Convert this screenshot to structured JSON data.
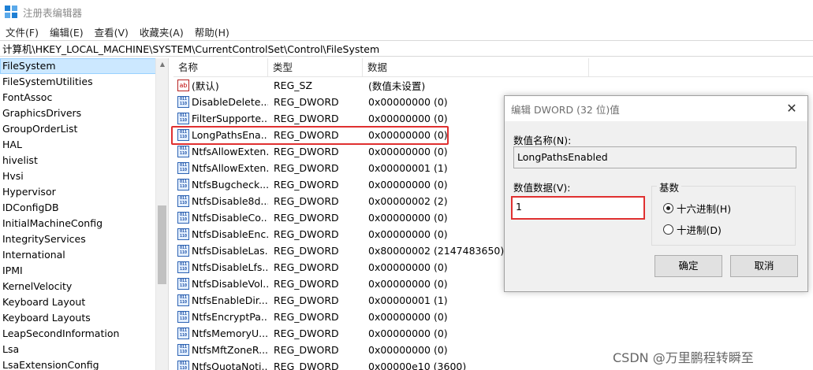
{
  "window": {
    "title": "注册表编辑器"
  },
  "menu": [
    "文件(F)",
    "编辑(E)",
    "查看(V)",
    "收藏夹(A)",
    "帮助(H)"
  ],
  "address": "计算机\\HKEY_LOCAL_MACHINE\\SYSTEM\\CurrentControlSet\\Control\\FileSystem",
  "tree": [
    "FileSystem",
    "FileSystemUtilities",
    "FontAssoc",
    "GraphicsDrivers",
    "GroupOrderList",
    "HAL",
    "hivelist",
    "Hvsi",
    "Hypervisor",
    "IDConfigDB",
    "InitialMachineConfig",
    "IntegrityServices",
    "International",
    "IPMI",
    "KernelVelocity",
    "Keyboard Layout",
    "Keyboard Layouts",
    "LeapSecondInformation",
    "Lsa",
    "LsaExtensionConfig"
  ],
  "list": {
    "headers": {
      "name": "名称",
      "type": "类型",
      "data": "数据"
    },
    "rows": [
      {
        "icon": "ab",
        "name": "(默认)",
        "type": "REG_SZ",
        "data": "(数值未设置)"
      },
      {
        "icon": "bin",
        "name": "DisableDelete...",
        "type": "REG_DWORD",
        "data": "0x00000000 (0)"
      },
      {
        "icon": "bin",
        "name": "FilterSupporte...",
        "type": "REG_DWORD",
        "data": "0x00000000 (0)"
      },
      {
        "icon": "bin",
        "name": "LongPathsEna...",
        "type": "REG_DWORD",
        "data": "0x00000000 (0)"
      },
      {
        "icon": "bin",
        "name": "NtfsAllowExten...",
        "type": "REG_DWORD",
        "data": "0x00000000 (0)"
      },
      {
        "icon": "bin",
        "name": "NtfsAllowExten...",
        "type": "REG_DWORD",
        "data": "0x00000001 (1)"
      },
      {
        "icon": "bin",
        "name": "NtfsBugcheck...",
        "type": "REG_DWORD",
        "data": "0x00000000 (0)"
      },
      {
        "icon": "bin",
        "name": "NtfsDisable8d...",
        "type": "REG_DWORD",
        "data": "0x00000002 (2)"
      },
      {
        "icon": "bin",
        "name": "NtfsDisableCo...",
        "type": "REG_DWORD",
        "data": "0x00000000 (0)"
      },
      {
        "icon": "bin",
        "name": "NtfsDisableEnc...",
        "type": "REG_DWORD",
        "data": "0x00000000 (0)"
      },
      {
        "icon": "bin",
        "name": "NtfsDisableLas...",
        "type": "REG_DWORD",
        "data": "0x80000002 (2147483650)"
      },
      {
        "icon": "bin",
        "name": "NtfsDisableLfs...",
        "type": "REG_DWORD",
        "data": "0x00000000 (0)"
      },
      {
        "icon": "bin",
        "name": "NtfsDisableVol...",
        "type": "REG_DWORD",
        "data": "0x00000000 (0)"
      },
      {
        "icon": "bin",
        "name": "NtfsEnableDir...",
        "type": "REG_DWORD",
        "data": "0x00000001 (1)"
      },
      {
        "icon": "bin",
        "name": "NtfsEncryptPa...",
        "type": "REG_DWORD",
        "data": "0x00000000 (0)"
      },
      {
        "icon": "bin",
        "name": "NtfsMemoryU...",
        "type": "REG_DWORD",
        "data": "0x00000000 (0)"
      },
      {
        "icon": "bin",
        "name": "NtfsMftZoneR...",
        "type": "REG_DWORD",
        "data": "0x00000000 (0)"
      },
      {
        "icon": "bin",
        "name": "NtfsQuotaNoti...",
        "type": "REG_DWORD",
        "data": "0x00000e10 (3600)"
      }
    ]
  },
  "dialog": {
    "title": "编辑 DWORD (32 位)值",
    "close": "✕",
    "name_label": "数值名称(N):",
    "name_value": "LongPathsEnabled",
    "data_label": "数值数据(V):",
    "data_value": "1",
    "base_label": "基数",
    "hex_label": "十六进制(H)",
    "dec_label": "十进制(D)",
    "selected_base": "hex",
    "ok": "确定",
    "cancel": "取消"
  },
  "watermark": "CSDN @万里鹏程转瞬至",
  "colors": {
    "highlight": "#e03030",
    "selection": "#cce8ff"
  }
}
